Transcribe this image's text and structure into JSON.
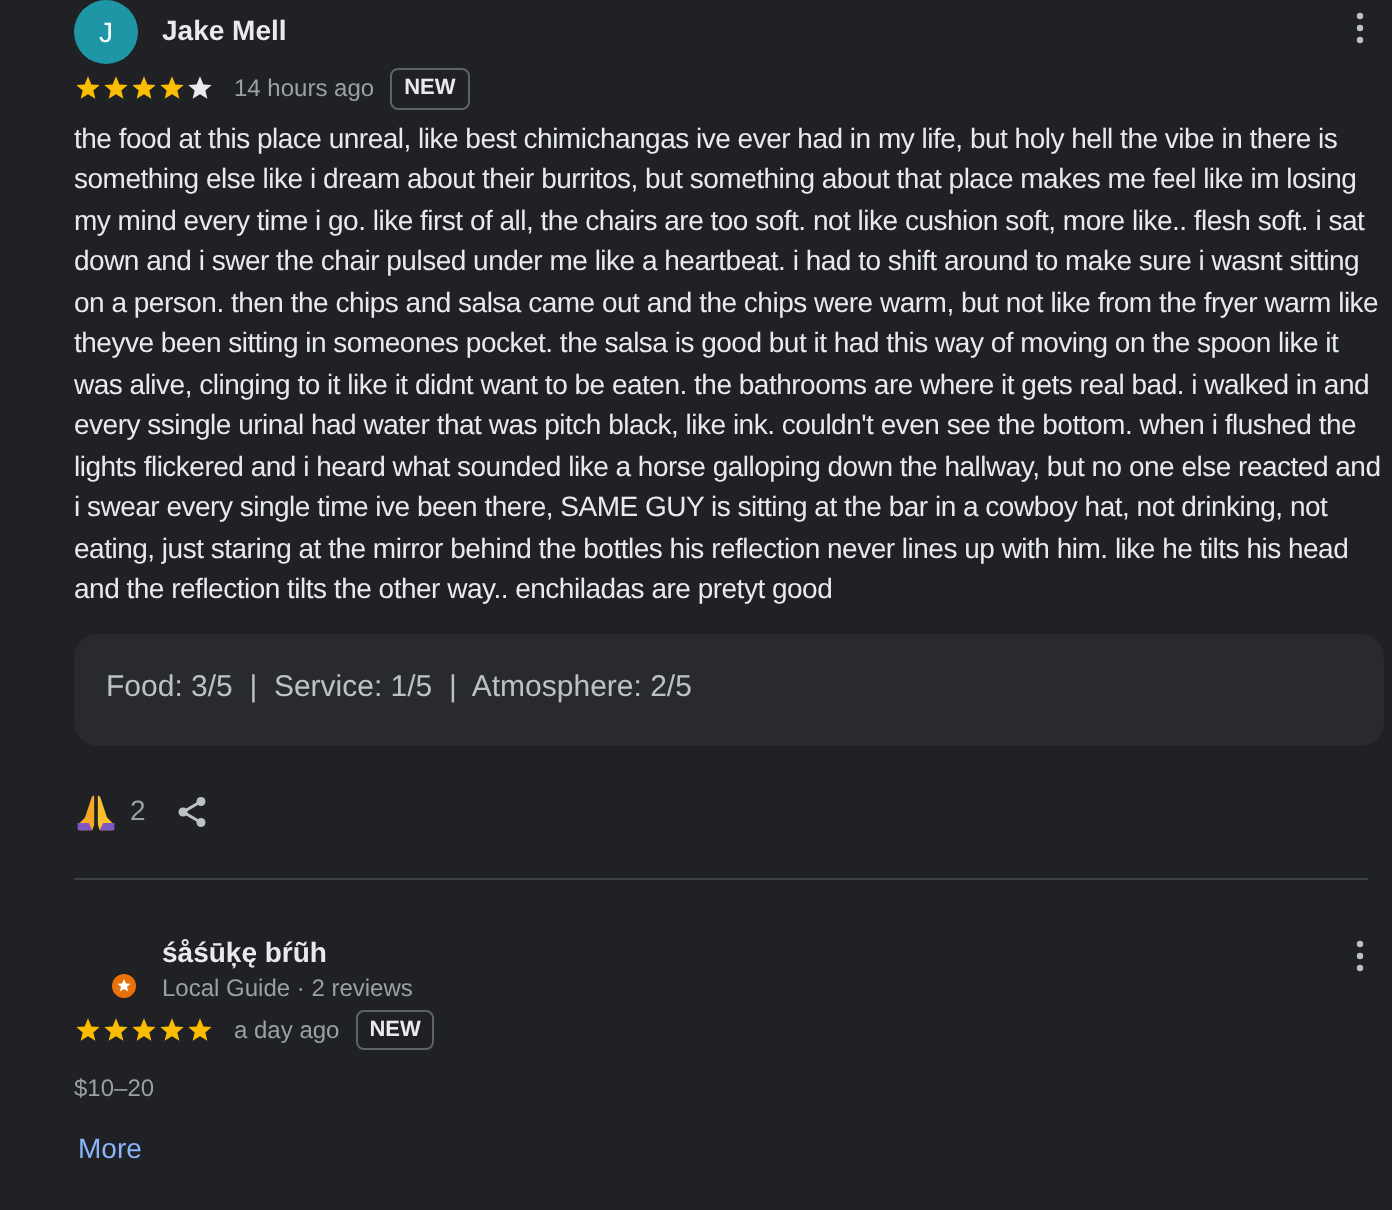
{
  "reviews": [
    {
      "avatar_letter": "J",
      "name": "Jake Mell",
      "stars": 4,
      "time": "14 hours ago",
      "badge": "NEW",
      "text": "the food at this place unreal, like best chimichangas ive ever had in my life, but holy hell the vibe in there is something else like i dream about their burritos, but something about that place makes me feel like im losing my mind every time i go. like first of all, the chairs are too soft. not like cushion soft, more like.. flesh soft. i sat down and i swer the chair pulsed under me like a heartbeat. i had to shift around to make sure i wasnt sitting on a person. then the chips and salsa came out and the chips were warm, but not like from the fryer warm like theyve been sitting in someones pocket. the salsa is good but it had this way of moving on the spoon like it was alive, clinging to it like it didnt want to be eaten. the bathrooms are where it gets real bad. i walked in and every ssingle urinal had water that was pitch black, like ink. couldn't even see the bottom. when i flushed the lights flickered and i heard what sounded like a horse galloping down the hallway, but no one else reacted and i swear every single time ive been there, SAME GUY is sitting at the bar in a cowboy hat, not drinking, not eating, just staring at the mirror behind the bottles his reflection never lines up with him. like he tilts his head and the reflection tilts the other way.. enchiladas are pretyt good",
      "ratings": "Food: 3/5  |  Service: 1/5  |  Atmosphere: 2/5",
      "reactions": "2"
    },
    {
      "name": "śåśūķę bŕũh",
      "subtitle": "Local Guide · 2 reviews",
      "stars": 5,
      "time": "a day ago",
      "badge": "NEW",
      "price": "$10–20",
      "more": "More"
    }
  ]
}
